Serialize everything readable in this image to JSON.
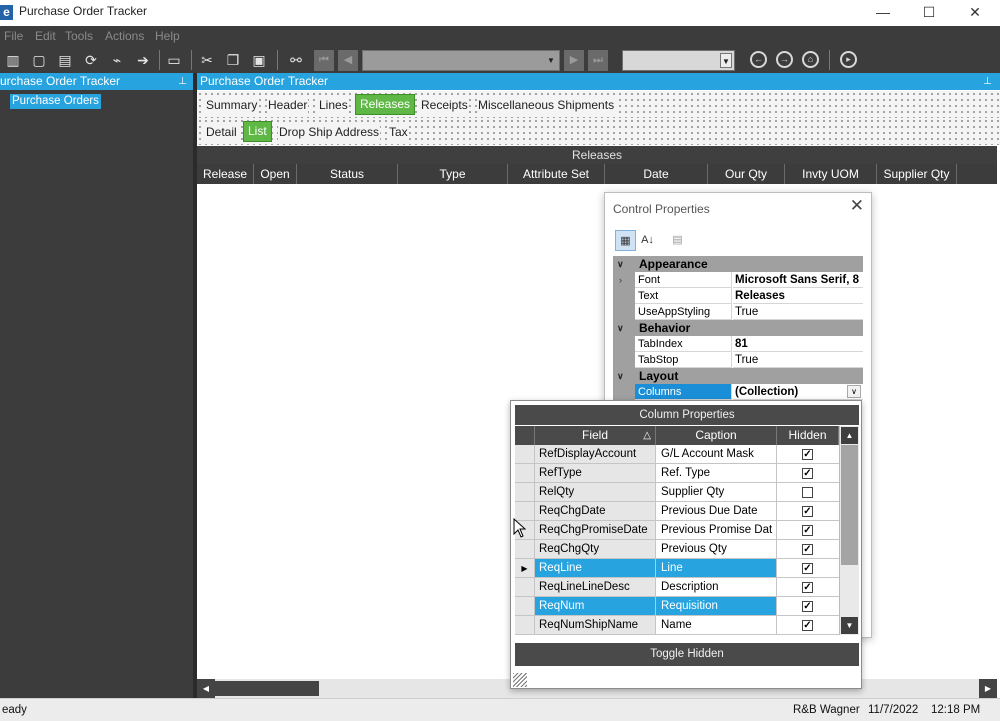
{
  "window": {
    "title": "Purchase Order Tracker",
    "icon_letter": "e",
    "controls": [
      "—",
      "☐",
      "✕"
    ]
  },
  "menu": [
    "File",
    "Edit",
    "Tools",
    "Actions",
    "Help"
  ],
  "left_panel": {
    "title": "urchase Order Tracker",
    "tree_item": "Purchase Orders"
  },
  "main_panel": {
    "title": "Purchase Order Tracker",
    "tabs": [
      "Summary",
      "Header",
      "Lines",
      "Releases",
      "Receipts",
      "Miscellaneous Shipments"
    ],
    "active_tab": "Releases",
    "subtabs": [
      "Detail",
      "List",
      "Drop Ship Address",
      "Tax"
    ],
    "active_subtab": "List",
    "grid_title": "Releases",
    "columns": [
      "Release",
      "Open",
      "Status",
      "Type",
      "Attribute Set",
      "Date",
      "Our Qty",
      "Invty UOM",
      "Supplier Qty"
    ]
  },
  "control_properties": {
    "title": "Control Properties",
    "categories": [
      {
        "name": "Appearance",
        "props": [
          {
            "name": "Font",
            "value": "Microsoft Sans Serif, 8",
            "bold": true,
            "expandable": true
          },
          {
            "name": "Text",
            "value": "Releases",
            "bold": true
          },
          {
            "name": "UseAppStyling",
            "value": "True",
            "bold": false
          }
        ]
      },
      {
        "name": "Behavior",
        "props": [
          {
            "name": "TabIndex",
            "value": "81",
            "bold": true
          },
          {
            "name": "TabStop",
            "value": "True",
            "bold": false
          }
        ]
      },
      {
        "name": "Layout",
        "props": [
          {
            "name": "Columns",
            "value": "(Collection)",
            "bold": true,
            "selected": true
          }
        ]
      }
    ]
  },
  "column_properties": {
    "title": "Column Properties",
    "headers": [
      "Field",
      "Caption",
      "Hidden"
    ],
    "rows": [
      {
        "field": "RefDisplayAccount",
        "caption": "G/L Account Mask",
        "hidden": true
      },
      {
        "field": "RefType",
        "caption": "Ref. Type",
        "hidden": true
      },
      {
        "field": "RelQty",
        "caption": "Supplier Qty",
        "hidden": false
      },
      {
        "field": "ReqChgDate",
        "caption": "Previous Due Date",
        "hidden": true
      },
      {
        "field": "ReqChgPromiseDate",
        "caption": "Previous Promise Dat",
        "hidden": true
      },
      {
        "field": "ReqChgQty",
        "caption": "Previous Qty",
        "hidden": true
      },
      {
        "field": "ReqLine",
        "caption": "Line",
        "hidden": true,
        "selected": true,
        "current": true
      },
      {
        "field": "ReqLineLineDesc",
        "caption": "Description",
        "hidden": true
      },
      {
        "field": "ReqNum",
        "caption": "Requisition",
        "hidden": true,
        "selected": true
      },
      {
        "field": "ReqNumShipName",
        "caption": "Name",
        "hidden": true
      }
    ],
    "toggle_button": "Toggle Hidden"
  },
  "status_bar": {
    "left": "eady",
    "user": "R&B Wagner",
    "date": "11/7/2022",
    "time": "12:18 PM"
  },
  "colors": {
    "accent_blue": "#27a3e0",
    "active_tab_green": "#5fb846",
    "dark_panel": "#3c3c3c"
  }
}
